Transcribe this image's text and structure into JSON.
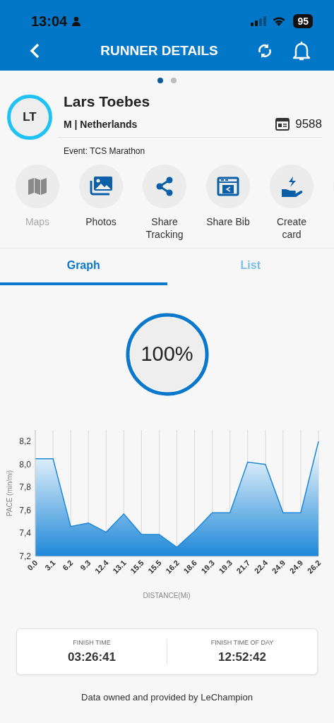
{
  "status_bar": {
    "time": "13:04",
    "battery": "95"
  },
  "header": {
    "title": "RUNNER DETAILS"
  },
  "pager": [
    {
      "selected": true
    },
    {
      "selected": false
    }
  ],
  "runner": {
    "initials": "LT",
    "name": "Lars Toebes",
    "info": "M | Netherlands",
    "bib": "9588",
    "event": "Event: TCS Marathon"
  },
  "actions": [
    {
      "label": "Maps",
      "kind": "map",
      "disabled": true
    },
    {
      "label": "Photos",
      "kind": "photos",
      "disabled": false
    },
    {
      "label": "Share Tracking",
      "kind": "share",
      "disabled": false
    },
    {
      "label": "Share Bib",
      "kind": "bib",
      "disabled": false
    },
    {
      "label": "Create card",
      "kind": "card",
      "disabled": false
    }
  ],
  "tabs": [
    {
      "label": "Graph",
      "selected": true
    },
    {
      "label": "List",
      "selected": false
    }
  ],
  "progress": {
    "label": "100%",
    "level": 1
  },
  "chart_data": {
    "type": "area",
    "xlabel": "DISTANCE(Mi)",
    "ylabel": "PACE (min/mi)",
    "categories": [
      "0.0",
      "3.1",
      "6.2",
      "9.3",
      "12.4",
      "13.1",
      "15.5",
      "15.5",
      "16.2",
      "18.6",
      "19.3",
      "19.3",
      "21.7",
      "22.4",
      "24.9",
      "24.9",
      "26.2"
    ],
    "grid": true,
    "series": [
      {
        "color": "#1e88d8",
        "values": [
          8.05,
          8.05,
          7.46,
          7.49,
          7.41,
          7.57,
          7.39,
          7.39,
          7.28,
          7.42,
          7.58,
          7.58,
          8.02,
          8.0,
          7.58,
          7.58,
          8.2
        ]
      }
    ],
    "ylim": [
      7.2,
      8.3
    ],
    "yticks": [
      {
        "value": 7.2,
        "label": "7,2"
      },
      {
        "value": 7.4,
        "label": "7,4"
      },
      {
        "value": 7.6,
        "label": "7,6"
      },
      {
        "value": 7.8,
        "label": "7,8"
      },
      {
        "value": 8.0,
        "label": "8,0"
      },
      {
        "value": 8.2,
        "label": "8,2"
      }
    ]
  },
  "summary": [
    {
      "label": "FINISH TIME",
      "value": "03:26:41"
    },
    {
      "label": "FINISH TIME OF DAY",
      "value": "12:52:42"
    }
  ],
  "footer": "Data owned and provided by LeChampion"
}
